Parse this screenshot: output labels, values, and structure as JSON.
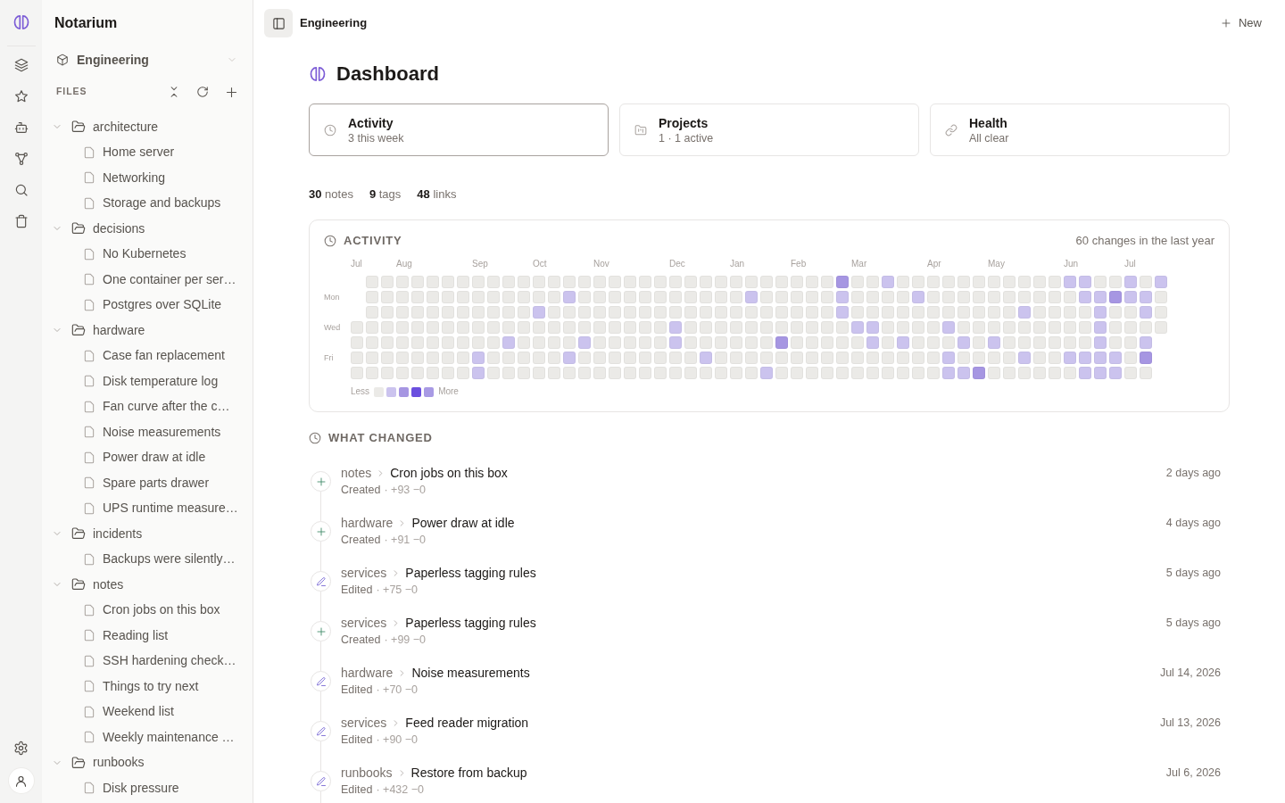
{
  "sidebar": {
    "app_name": "Notarium",
    "workspace": "Engineering",
    "section_label": "FILES",
    "tree": [
      {
        "label": "architecture",
        "expanded": true,
        "children": [
          {
            "label": "Home server"
          },
          {
            "label": "Networking"
          },
          {
            "label": "Storage and backups"
          }
        ]
      },
      {
        "label": "decisions",
        "expanded": true,
        "children": [
          {
            "label": "No Kubernetes"
          },
          {
            "label": "One container per ser…"
          },
          {
            "label": "Postgres over SQLite"
          }
        ]
      },
      {
        "label": "hardware",
        "expanded": true,
        "children": [
          {
            "label": "Case fan replacement"
          },
          {
            "label": "Disk temperature log"
          },
          {
            "label": "Fan curve after the c…"
          },
          {
            "label": "Noise measurements"
          },
          {
            "label": "Power draw at idle"
          },
          {
            "label": "Spare parts drawer"
          },
          {
            "label": "UPS runtime measure…"
          }
        ]
      },
      {
        "label": "incidents",
        "expanded": true,
        "children": [
          {
            "label": "Backups were silently…"
          }
        ]
      },
      {
        "label": "notes",
        "expanded": true,
        "children": [
          {
            "label": "Cron jobs on this box"
          },
          {
            "label": "Reading list"
          },
          {
            "label": "SSH hardening check…"
          },
          {
            "label": "Things to try next"
          },
          {
            "label": "Weekend list"
          },
          {
            "label": "Weekly maintenance …"
          }
        ]
      },
      {
        "label": "runbooks",
        "expanded": true,
        "children": [
          {
            "label": "Disk pressure"
          }
        ]
      }
    ]
  },
  "header": {
    "title": "Engineering",
    "new_button": "New"
  },
  "dashboard": {
    "title": "Dashboard",
    "cards": [
      {
        "title": "Activity",
        "subtitle": "3 this week",
        "selected": true
      },
      {
        "title": "Projects",
        "subtitle": "1 · 1 active",
        "selected": false
      },
      {
        "title": "Health",
        "subtitle": "All clear",
        "selected": false
      }
    ],
    "stats": [
      "**30** notes",
      "**9** tags",
      "**48** links"
    ],
    "activity": {
      "title": "ACTIVITY",
      "summary": "60 changes in the last year",
      "months": [
        "Jul",
        "Aug",
        "Sep",
        "Oct",
        "Nov",
        "Dec",
        "Jan",
        "Feb",
        "Mar",
        "Apr",
        "May",
        "Jun",
        "Jul"
      ],
      "weekdays": [
        "Mon",
        "Wed",
        "Fri"
      ],
      "legend": {
        "less": "Less",
        "more": "More",
        "swatches": [
          {
            "color": "#ebeae7"
          },
          {
            "color": "#cbc3ee"
          },
          {
            "color": "#a696e2"
          },
          {
            "color": "#6b4fdf"
          },
          {
            "color": "#a89ae4"
          }
        ]
      }
    },
    "changes": {
      "title": "WHAT CHANGED",
      "items": [
        {
          "kind": "created",
          "folder": "notes",
          "title": "Cron jobs on this box",
          "action": "Created",
          "diff": "· +93 −0",
          "time": "2 days ago"
        },
        {
          "kind": "created",
          "folder": "hardware",
          "title": "Power draw at idle",
          "action": "Created",
          "diff": "· +91 −0",
          "time": "4 days ago"
        },
        {
          "kind": "edited",
          "folder": "services",
          "title": "Paperless tagging rules",
          "action": "Edited",
          "diff": "· +75 −0",
          "time": "5 days ago"
        },
        {
          "kind": "created",
          "folder": "services",
          "title": "Paperless tagging rules",
          "action": "Created",
          "diff": "· +99 −0",
          "time": "5 days ago"
        },
        {
          "kind": "edited",
          "folder": "hardware",
          "title": "Noise measurements",
          "action": "Edited",
          "diff": "· +70 −0",
          "time": "Jul 14, 2026"
        },
        {
          "kind": "edited",
          "folder": "services",
          "title": "Feed reader migration",
          "action": "Edited",
          "diff": "· +90 −0",
          "time": "Jul 13, 2026"
        },
        {
          "kind": "edited",
          "folder": "runbooks",
          "title": "Restore from backup",
          "action": "Edited",
          "diff": "· +432 −0",
          "time": "Jul 6, 2026"
        }
      ]
    }
  }
}
